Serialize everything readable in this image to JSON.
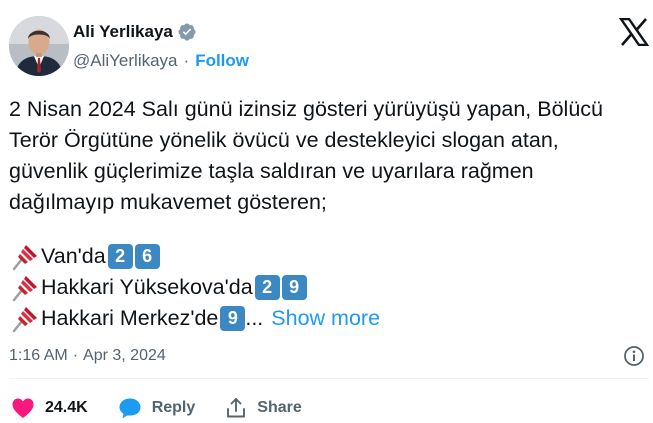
{
  "author": {
    "display_name": "Ali Yerlikaya",
    "handle": "@AliYerlikaya",
    "separator": "·",
    "follow_label": "Follow",
    "verified_icon": "verified-badge-icon"
  },
  "tweet": {
    "paragraph": "2 Nisan 2024 Salı günü izinsiz gösteri yürüyüşü yapan, Bölücü Terör Örgütüne yönelik övücü ve destekleyici slogan atan, güvenlik güçlerimize taşla saldıran ve uyarılara rağmen dağılmayıp mukavemet gösteren;",
    "lines": [
      {
        "text": "Van'da",
        "digits": [
          "2",
          "6"
        ],
        "ellipsis": ""
      },
      {
        "text": "Hakkari Yüksekova'da",
        "digits": [
          "2",
          "9"
        ],
        "ellipsis": ""
      },
      {
        "text": "Hakkari Merkez'de",
        "digits": [
          "9"
        ],
        "ellipsis": "..."
      }
    ],
    "show_more_label": "Show more",
    "line_icon": "pushpin-icon"
  },
  "meta": {
    "time": "1:16 AM",
    "separator": "·",
    "date": "Apr 3, 2024"
  },
  "actions": {
    "likes": "24.4K",
    "reply_label": "Reply",
    "share_label": "Share"
  },
  "colors": {
    "accent": "#1d9bf0",
    "like": "#f91880",
    "keycap": "#3b88c3",
    "secondary_text": "#536471"
  }
}
